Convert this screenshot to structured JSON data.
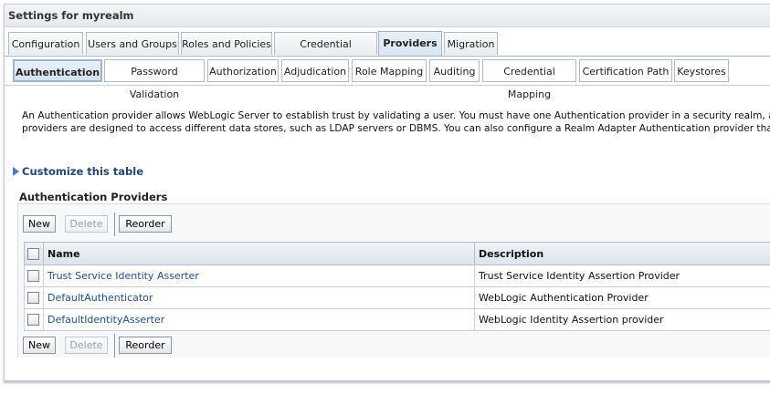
{
  "page": {
    "title": "Settings for myrealm"
  },
  "tabs": [
    {
      "label": "Configuration",
      "active": false
    },
    {
      "label": "Users and Groups",
      "active": false
    },
    {
      "label": "Roles and Policies",
      "active": false
    },
    {
      "label": "Credential Mappings",
      "active": false
    },
    {
      "label": "Providers",
      "active": true
    },
    {
      "label": "Migration",
      "active": false
    }
  ],
  "subtabs": [
    {
      "label": "Authentication",
      "active": true
    },
    {
      "label": "Password Validation",
      "active": false
    },
    {
      "label": "Authorization",
      "active": false
    },
    {
      "label": "Adjudication",
      "active": false
    },
    {
      "label": "Role Mapping",
      "active": false
    },
    {
      "label": "Auditing",
      "active": false
    },
    {
      "label": "Credential Mapping",
      "active": false
    },
    {
      "label": "Certification Path",
      "active": false
    },
    {
      "label": "Keystores",
      "active": false
    }
  ],
  "description": {
    "line1": "An Authentication provider allows WebLogic Server to establish trust by validating a user. You must have one Authentication provider in a security realm, and you can conf",
    "line2": "providers are designed to access different data stores, such as LDAP servers or DBMS. You can also configure a Realm Adapter Authentication provider that allows you to"
  },
  "customize": {
    "label": "Customize this table",
    "icon": "expand-triangle-icon"
  },
  "providers_table": {
    "title": "Authentication Providers",
    "buttons": {
      "new": "New",
      "delete": "Delete",
      "reorder": "Reorder"
    },
    "columns": {
      "name": "Name",
      "description": "Description"
    },
    "rows": [
      {
        "name": "Trust Service Identity Asserter",
        "description": "Trust Service Identity Assertion Provider"
      },
      {
        "name": "DefaultAuthenticator",
        "description": "WebLogic Authentication Provider"
      },
      {
        "name": "DefaultIdentityAsserter",
        "description": "WebLogic Identity Assertion provider"
      }
    ]
  },
  "colors": {
    "link": "#224f99",
    "tab_active_bg": "#d8e5f1",
    "border": "#9fb4c8"
  }
}
